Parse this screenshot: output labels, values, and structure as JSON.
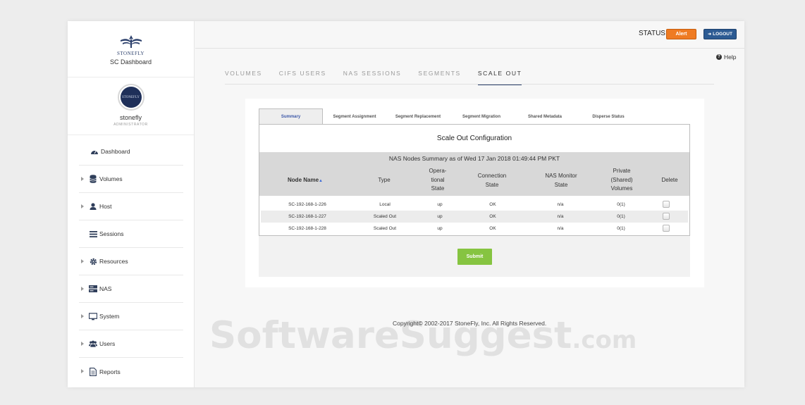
{
  "brand": {
    "logo_text": "STONEFLY",
    "subtitle": "SC Dashboard"
  },
  "profile": {
    "username": "stonefly",
    "role": "ADMINISTRATOR",
    "avatar_text": "STONEFLY"
  },
  "sidebar": {
    "items": [
      {
        "label": "Dashboard",
        "icon": "dashboard-icon"
      },
      {
        "label": "Volumes",
        "icon": "database-icon"
      },
      {
        "label": "Host",
        "icon": "user-icon"
      },
      {
        "label": "Sessions",
        "icon": "list-icon"
      },
      {
        "label": "Resources",
        "icon": "gear-icon"
      },
      {
        "label": "NAS",
        "icon": "server-icon"
      },
      {
        "label": "System",
        "icon": "monitor-icon"
      },
      {
        "label": "Users",
        "icon": "users-icon"
      },
      {
        "label": "Reports",
        "icon": "file-icon"
      }
    ]
  },
  "header": {
    "status_label": "STATUS:",
    "alert_label": "Alert",
    "logout_label": "LOGOUT",
    "help_label": "Help"
  },
  "main_tabs": [
    "VOLUMES",
    "CIFS USERS",
    "NAS SESSIONS",
    "SEGMENTS",
    "SCALE OUT"
  ],
  "active_main_tab": "SCALE OUT",
  "sub_tabs": [
    "Summary",
    "Segment Assignment",
    "Segment Replacement",
    "Segment Migration",
    "Shared Metadata",
    "Disperse Status"
  ],
  "panel": {
    "title": "Scale Out Configuration",
    "summary": "NAS Nodes Summary as of Wed 17 Jan 2018 01:49:44 PM PKT",
    "columns": {
      "node_name": "Node Name",
      "type": "Type",
      "operational_state": [
        "Opera-",
        "tional",
        "State"
      ],
      "connection_state": [
        "Connection",
        "State"
      ],
      "nas_monitor_state": [
        "NAS Monitor",
        "State"
      ],
      "private_volumes": [
        "Private",
        "(Shared)",
        "Volumes"
      ],
      "delete": "Delete"
    },
    "rows": [
      {
        "node": "SC-192-168-1-226",
        "type": "Local",
        "op_state": "up",
        "conn_state": "OK",
        "monitor": "n/a",
        "volumes": "0(1)"
      },
      {
        "node": "SC-192-168-1-227",
        "type": "Scaled Out",
        "op_state": "up",
        "conn_state": "OK",
        "monitor": "n/a",
        "volumes": "0(1)"
      },
      {
        "node": "SC-192-168-1-228",
        "type": "Scaled Out",
        "op_state": "up",
        "conn_state": "OK",
        "monitor": "n/a",
        "volumes": "0(1)"
      }
    ],
    "submit_label": "Submit"
  },
  "footer": {
    "copyright": "Copyright© 2002-2017 StoneFly, Inc. All Rights Reserved."
  },
  "watermark": {
    "main": "SoftwareSuggest",
    "suffix": ".com"
  },
  "colors": {
    "alert": "#ef7b22",
    "logout": "#2c5b93",
    "submit": "#86c441",
    "brand_navy": "#2b3f6b"
  }
}
